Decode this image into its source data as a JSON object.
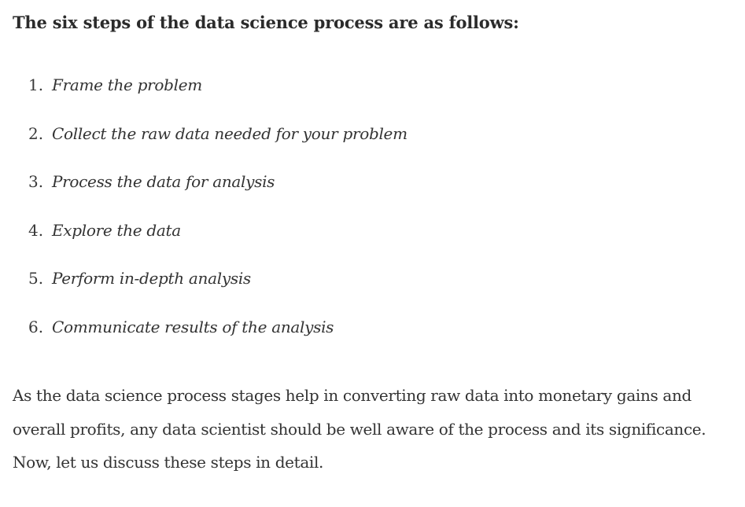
{
  "intro": "The six steps of the data science process are as follows:",
  "steps": [
    {
      "num": "1.",
      "text": "Frame the problem"
    },
    {
      "num": "2.",
      "text": "Collect the raw data needed for your problem"
    },
    {
      "num": "3.",
      "text": "Process the data for analysis"
    },
    {
      "num": "4.",
      "text": "Explore the data"
    },
    {
      "num": "5.",
      "text": "Perform in-depth analysis"
    },
    {
      "num": "6.",
      "text": "Communicate results of the analysis"
    }
  ],
  "paragraph": "As the data science process stages help in converting raw data into monetary gains and overall profits, any data scientist should be well aware of the process and its significance. Now, let us discuss these steps in detail."
}
